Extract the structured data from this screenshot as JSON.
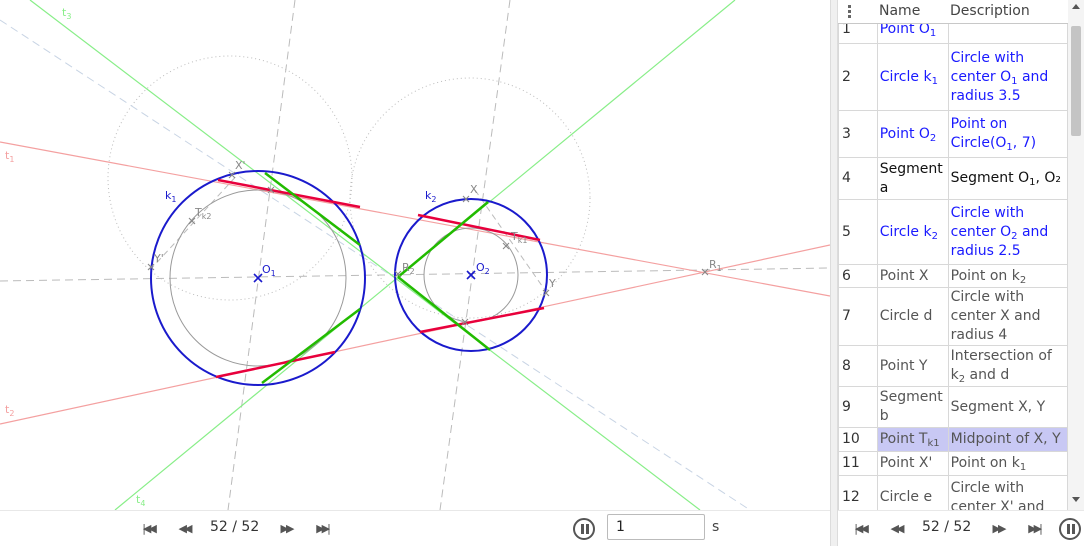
{
  "graphics": {
    "labels": {
      "k1": "k",
      "k1_sub": "1",
      "k2": "k",
      "k2_sub": "2",
      "O1": "O",
      "O1_sub": "1",
      "O2": "O",
      "O2_sub": "2",
      "R1": "R",
      "R1_sub": "1",
      "R2": "R",
      "R2_sub": "2",
      "t1": "t",
      "t1_sub": "1",
      "t2": "t",
      "t2_sub": "2",
      "t3": "t",
      "t3_sub": "3",
      "t4": "t",
      "t4_sub": "4",
      "X": "X",
      "Xp": "X'",
      "Y": "Y",
      "Yp": "Y'",
      "Tk1": "T",
      "Tk1_sub": "k1",
      "Tk2": "T",
      "Tk2_sub": "k2"
    },
    "colors": {
      "blue": "#1a1acc",
      "red": "#e8003c",
      "green": "#22bb00",
      "light_red": "#f4a0a0",
      "light_green": "#88ee88",
      "gray": "#999999"
    }
  },
  "bottom_bar": {
    "step_counter": "52 / 52",
    "speed_value": "1",
    "speed_unit": "s"
  },
  "protocol": {
    "header": {
      "name": "Name",
      "description": "Description"
    },
    "rows": [
      {
        "num": "1",
        "name": "Point O",
        "name_sub": "1",
        "desc": "",
        "desc_sub": "",
        "desc_tail": "",
        "style": "blue"
      },
      {
        "num": "2",
        "name": "Circle k",
        "name_sub": "1",
        "desc": "Circle with center O",
        "desc_sub": "1",
        "desc_tail": " and radius 3.5",
        "style": "blue"
      },
      {
        "num": "3",
        "name": "Point O",
        "name_sub": "2",
        "desc": "Point on Circle(O",
        "desc_sub": "1",
        "desc_tail": ", 7)",
        "style": "blue"
      },
      {
        "num": "4",
        "name": "Segment a",
        "name_sub": "",
        "desc": "Segment O",
        "desc_sub": "1",
        "desc_tail": ", O₂",
        "style": "black"
      },
      {
        "num": "5",
        "name": "Circle k",
        "name_sub": "2",
        "desc": "Circle with center O",
        "desc_sub": "2",
        "desc_tail": " and radius 2.5",
        "style": "blue"
      },
      {
        "num": "6",
        "name": "Point X",
        "name_sub": "",
        "desc": "Point on k",
        "desc_sub": "2",
        "desc_tail": "",
        "style": "gray"
      },
      {
        "num": "7",
        "name": "Circle d",
        "name_sub": "",
        "desc": "Circle with center X and radius 4",
        "desc_sub": "",
        "desc_tail": "",
        "style": "gray"
      },
      {
        "num": "8",
        "name": "Point Y",
        "name_sub": "",
        "desc": "Intersection of k",
        "desc_sub": "2",
        "desc_tail": " and d",
        "style": "gray"
      },
      {
        "num": "9",
        "name": "Segment b",
        "name_sub": "",
        "desc": "Segment X, Y",
        "desc_sub": "",
        "desc_tail": "",
        "style": "gray"
      },
      {
        "num": "10",
        "name": "Point T",
        "name_sub": "k1",
        "desc": "Midpoint of X, Y",
        "desc_sub": "",
        "desc_tail": "",
        "style": "sel"
      },
      {
        "num": "11",
        "name": "Point X'",
        "name_sub": "",
        "desc": "Point on k",
        "desc_sub": "1",
        "desc_tail": "",
        "style": "gray"
      },
      {
        "num": "12",
        "name": "Circle e",
        "name_sub": "",
        "desc": "Circle with center X' and",
        "desc_sub": "",
        "desc_tail": "",
        "style": "gray"
      }
    ],
    "step_counter": "52 / 52"
  }
}
